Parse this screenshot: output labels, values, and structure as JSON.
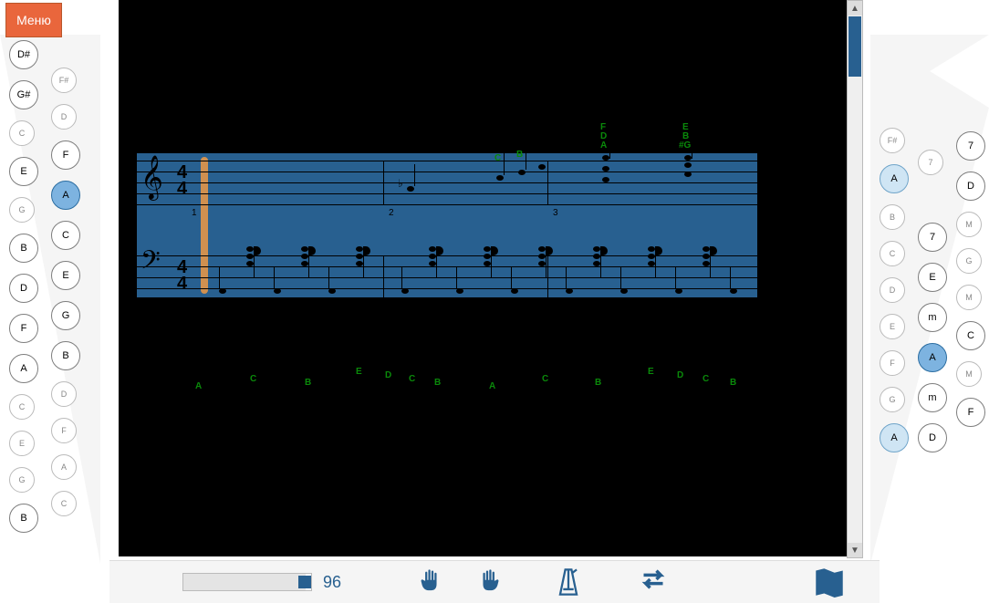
{
  "menu_label": "Меню",
  "tempo": "96",
  "left_col1": [
    "D#",
    "G#",
    "C",
    "E",
    "G",
    "B",
    "D",
    "F",
    "A",
    "C",
    "E",
    "G",
    "B"
  ],
  "left_col2": [
    "F#",
    "D",
    "F",
    "A",
    "C",
    "E",
    "G",
    "B",
    "D",
    "F",
    "A",
    "C"
  ],
  "right_col1": [
    "F#",
    "A",
    "B",
    "C",
    "D",
    "E",
    "F",
    "G",
    "A"
  ],
  "right_col2": [
    "7",
    "7",
    "E",
    "m",
    "A",
    "m",
    "D"
  ],
  "right_col3": [
    "7",
    "D",
    "M",
    "G",
    "M",
    "C",
    "M",
    "F"
  ],
  "measure_numbers": [
    "1",
    "2",
    "3"
  ],
  "treble_names": [
    "C",
    "B",
    "F",
    "D",
    "A",
    "E",
    "B",
    "#G"
  ],
  "row2_names": [
    "A",
    "C",
    "B",
    "E",
    "D",
    "C",
    "B",
    "A",
    "C",
    "B",
    "E",
    "D",
    "C",
    "B"
  ]
}
